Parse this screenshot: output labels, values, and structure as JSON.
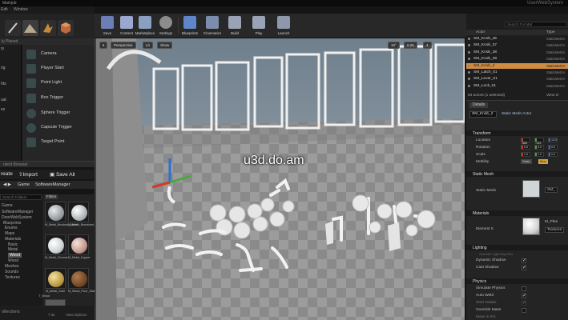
{
  "titlebar": {
    "tab": "Mainjob",
    "project": "UserWebSystem"
  },
  "menu": {
    "edit": "Edit",
    "window": "Window"
  },
  "place_panel": {
    "label": "ly Placed",
    "categories": [
      "ry",
      "ng",
      "hts",
      "ual",
      "es"
    ],
    "items": [
      {
        "label": "Camera"
      },
      {
        "label": "Player Start"
      },
      {
        "label": "Point Light"
      },
      {
        "label": "Box Trigger"
      },
      {
        "label": "Sphere Trigger"
      },
      {
        "label": "Capsule Trigger"
      },
      {
        "label": "Target Point"
      }
    ]
  },
  "content_browser": {
    "header": "ntent Browser",
    "create_label": "reate",
    "import_label": "Import",
    "save_all_label": "Save All",
    "path": [
      "Game",
      "SoftwareManager"
    ],
    "search_placeholder": "Search Folders",
    "filters_label": "Filters",
    "tree": [
      {
        "label": "Game",
        "sel": false
      },
      {
        "label": "SoftwareManager",
        "sel": false
      },
      {
        "label": "DoorWebSystem",
        "sel": false
      },
      {
        "label": "Blueprints",
        "sel": false
      },
      {
        "label": "Enums",
        "sel": false
      },
      {
        "label": "Maps",
        "sel": false
      },
      {
        "label": "Materials",
        "sel": false
      },
      {
        "label": "Basic",
        "sel": false
      },
      {
        "label": "Metal",
        "sel": false
      },
      {
        "label": "Wood",
        "sel": true
      },
      {
        "label": "Wood",
        "sel": false
      },
      {
        "label": "Meshes",
        "sel": false
      },
      {
        "label": "Sounds",
        "sel": false
      },
      {
        "label": "Textures",
        "sel": false
      }
    ],
    "assets": [
      {
        "label": "M_Metal_Brushed_Nickel",
        "color": "#9fa4a8"
      },
      {
        "label": "M_Metal_Burnished_Steel",
        "color": "#b8bcbf"
      },
      {
        "label": "M_Metal_Chrome",
        "color": "#dfe4e6"
      },
      {
        "label": "M_Metal_Copper",
        "color": "#cfa69a"
      },
      {
        "label": "M_Metal_Gold",
        "color": "#c8a64f"
      },
      {
        "label": "M_Wood_Floor_Walnut",
        "color": "#7a5030"
      },
      {
        "label": "T_Wood",
        "color": "#5d5d5d"
      }
    ],
    "footer": "ollections",
    "item_count": "7 ite",
    "view_options": "View Options"
  },
  "toolbar": {
    "buttons": [
      {
        "label": "Save",
        "color": "#6d7db6"
      },
      {
        "label": "Content",
        "color": "#9aa8cf"
      },
      {
        "label": "Marketplace",
        "color": "#8aa0c0"
      },
      {
        "label": "Settings",
        "color": "#8c8c8c"
      },
      {
        "label": "Blueprints",
        "color": "#5f86c8"
      },
      {
        "label": "Cinematics",
        "color": "#7c8cad"
      },
      {
        "label": "Build",
        "color": "#9aa3b5"
      },
      {
        "label": "Play",
        "color": "#9aa3b5"
      },
      {
        "label": "Launch",
        "color": "#8e97ab"
      }
    ]
  },
  "viewport": {
    "perspective_label": "Perspective",
    "lit_label": "Lit",
    "show_label": "Show",
    "snap_angle": "10°",
    "snap_scale": "0.25",
    "camera_speed": "4",
    "watermark": "u3d.do.am"
  },
  "outliner": {
    "search_placeholder": "Search For Mat",
    "col_label": "Actor",
    "col_type": "Type",
    "rows": [
      {
        "name": "SM_Knob_36",
        "type": "StaticMeshA",
        "sel": false
      },
      {
        "name": "SM_Knob_37",
        "type": "StaticMeshA",
        "sel": false
      },
      {
        "name": "SM_Knob_38",
        "type": "StaticMeshA",
        "sel": false
      },
      {
        "name": "SM_Knob_39",
        "type": "StaticMeshA",
        "sel": false
      },
      {
        "name": "SM_Knob_2",
        "type": "StaticMeshA",
        "sel": true
      },
      {
        "name": "SM_Latch_01",
        "type": "StaticMeshA",
        "sel": false
      },
      {
        "name": "SM_Lever_01",
        "type": "StaticMeshA",
        "sel": false
      },
      {
        "name": "SM_Lock_01",
        "type": "StaticMeshA",
        "sel": false
      }
    ],
    "footer": "64 actors (1 selected)",
    "view_options": "View O"
  },
  "details": {
    "tab": "Details",
    "object_name": "SM_Knob_2",
    "link": "Static Mesh Actor",
    "transform": "Transform",
    "location_label": "Location",
    "rotation_label": "Rotation",
    "scale_label": "Scale",
    "mobility_label": "Mobility",
    "mobility_options": [
      "Static",
      "Mov"
    ],
    "location": [
      "-680",
      "-133",
      "13.9"
    ],
    "rotation": [
      "0.0",
      "0.0",
      "0.0"
    ],
    "scale": [
      "1.0",
      "1.0",
      "1.0"
    ],
    "static_mesh_section": "Static Mesh",
    "static_mesh_label": "Static Mesh",
    "static_mesh_value": "SM_",
    "materials_section": "Materials",
    "element_label": "Element 0",
    "material_value": "M_Plas",
    "material_source": "Textures",
    "lighting_section": "Lighting",
    "lighting_override": "Override Light Map Res",
    "dynamic_shadow": "Dynamic Shadow",
    "cast_shadow": "Cast Shadow",
    "physics_section": "Physics",
    "simulate_physics": "Simulate Physics",
    "auto_weld": "Auto Weld",
    "start_awake": "Start Awake",
    "override_mass": "Override Mass",
    "mass": "Mass in KG"
  }
}
